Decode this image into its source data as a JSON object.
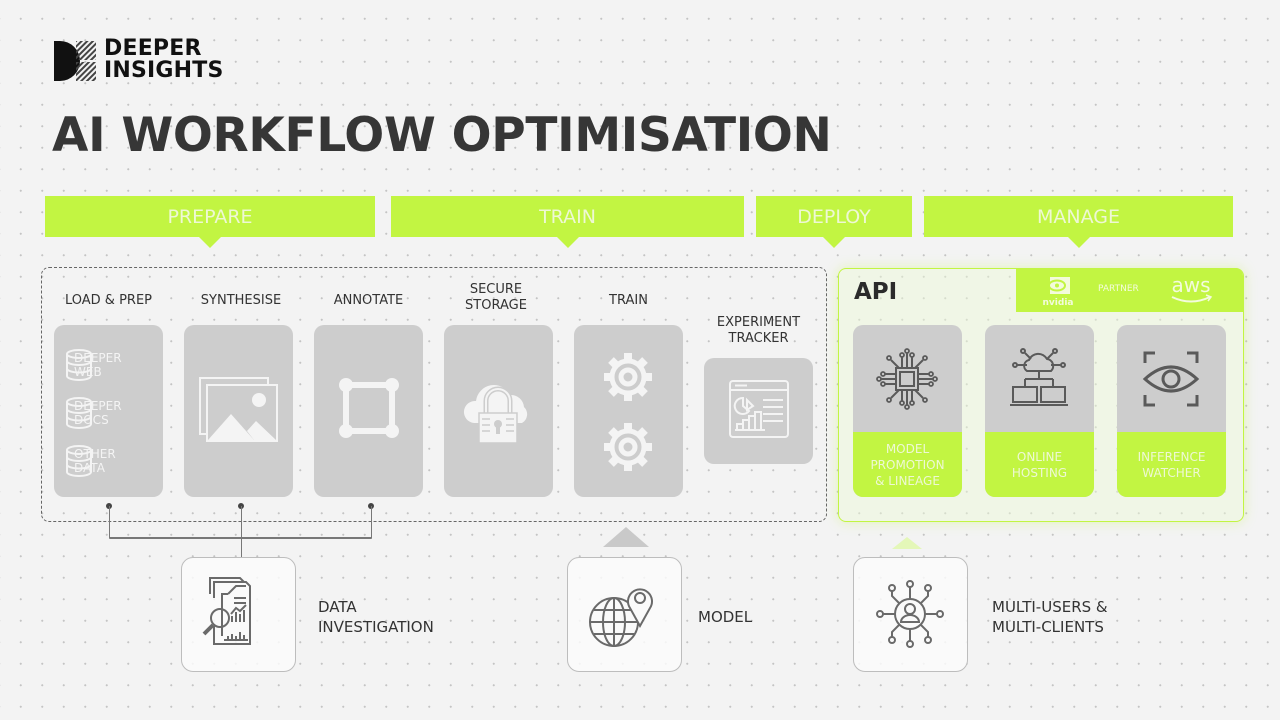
{
  "brand": {
    "line1": "DEEPER",
    "line2": "INSIGHTS"
  },
  "title": "AI WORKFLOW OPTIMISATION",
  "colors": {
    "accent": "#c2f542",
    "card": "#cdcdcd",
    "text": "#363636",
    "background": "#f3f3f3"
  },
  "phases": [
    {
      "label": "PREPARE"
    },
    {
      "label": "TRAIN"
    },
    {
      "label": "DEPLOY"
    },
    {
      "label": "MANAGE"
    }
  ],
  "stages": {
    "load_prep": {
      "label": "LOAD & PREP",
      "sources": [
        {
          "line1": "DEEPER",
          "line2": "WEB",
          "icon": "database-icon"
        },
        {
          "line1": "DEEPER",
          "line2": "DOCS",
          "icon": "database-icon"
        },
        {
          "line1": "OTHER",
          "line2": "DATA",
          "icon": "database-icon"
        }
      ]
    },
    "synthesise": {
      "label": "SYNTHESISE",
      "icon": "image-gallery-icon"
    },
    "annotate": {
      "label": "ANNOTATE",
      "icon": "bounding-box-icon"
    },
    "secure_storage": {
      "line1": "SECURE",
      "line2": "STORAGE",
      "icon": "cloud-lock-icon"
    },
    "train": {
      "label": "TRAIN",
      "icon": "gears-icon"
    },
    "experiment_tracker": {
      "line1": "EXPERIMENT",
      "line2": "TRACKER",
      "icon": "dashboard-chart-icon"
    }
  },
  "api": {
    "title": "API",
    "partner_label": "PARTNER",
    "partners": [
      "nvidia",
      "aws"
    ],
    "cards": [
      {
        "line1": "MODEL",
        "line2": "PROMOTION",
        "line3": "& LINEAGE",
        "icon": "chip-icon"
      },
      {
        "line1": "ONLINE",
        "line2": "HOSTING",
        "icon": "cloud-network-icon"
      },
      {
        "line1": "INFERENCE",
        "line2": "WATCHER",
        "icon": "eye-scan-icon"
      }
    ]
  },
  "bottom": [
    {
      "line1": "DATA",
      "line2": "INVESTIGATION",
      "icon": "report-search-icon"
    },
    {
      "line1": "MODEL",
      "icon": "globe-pin-icon"
    },
    {
      "line1": "MULTI-USERS &",
      "line2": "MULTI-CLIENTS",
      "icon": "user-network-icon"
    }
  ]
}
